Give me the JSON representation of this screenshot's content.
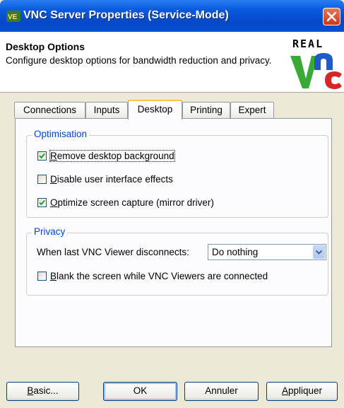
{
  "window": {
    "title": "VNC Server Properties (Service-Mode)"
  },
  "header": {
    "title": "Desktop Options",
    "description": "Configure desktop options for bandwidth reduction and privacy.",
    "logo_text": "REAL VNC"
  },
  "tabs": [
    {
      "label": "Connections",
      "active": false
    },
    {
      "label": "Inputs",
      "active": false
    },
    {
      "label": "Desktop",
      "active": true
    },
    {
      "label": "Printing",
      "active": false
    },
    {
      "label": "Expert",
      "active": false
    }
  ],
  "optimisation": {
    "legend": "Optimisation",
    "options": [
      {
        "mnemonic": "R",
        "rest": "emove desktop background",
        "checked": true
      },
      {
        "mnemonic": "D",
        "rest": "isable user interface effects",
        "checked": false
      },
      {
        "mnemonic": "O",
        "rest": "ptimize screen capture (mirror driver)",
        "checked": true
      }
    ]
  },
  "privacy": {
    "legend": "Privacy",
    "disconnect_label": "When last VNC Viewer disconnects:",
    "disconnect_value": "Do nothing",
    "blank_checkbox": {
      "mnemonic": "B",
      "rest": "lank the screen while VNC Viewers are connected",
      "checked": false
    }
  },
  "buttons": {
    "basic": {
      "mnemonic": "B",
      "rest": "asic..."
    },
    "ok": "OK",
    "cancel": "Annuler",
    "apply": {
      "mnemonic": "A",
      "rest": "ppliquer"
    }
  },
  "colors": {
    "title_bar": "#0A5BDE",
    "face": "#ECE9D8",
    "group_legend": "#0046D5",
    "tab_highlight": "#FFC83C"
  }
}
